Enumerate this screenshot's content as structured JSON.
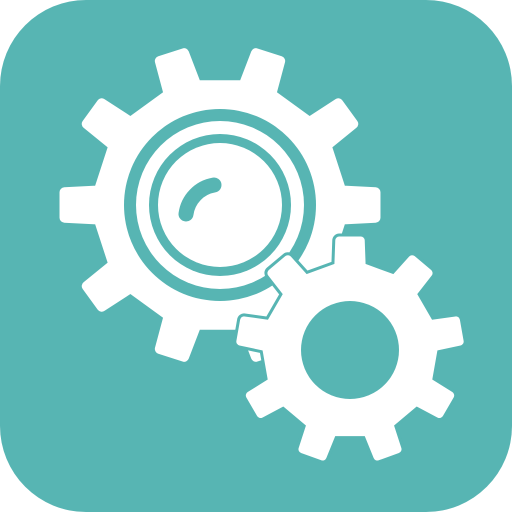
{
  "icon": {
    "name": "settings-gears-app-icon",
    "background_color": "#57B5B3",
    "foreground_color": "#FFFFFF"
  }
}
